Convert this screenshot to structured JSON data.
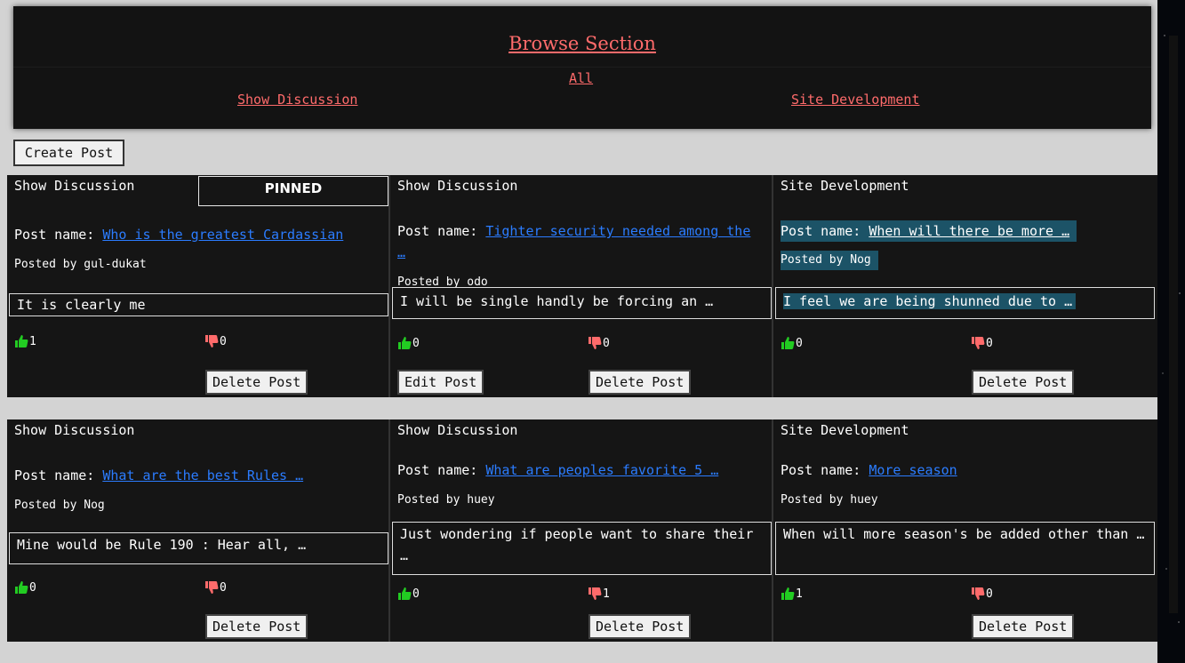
{
  "browse": {
    "title": "Browse Section",
    "links": {
      "all": "All",
      "show_discussion": "Show Discussion",
      "site_development": "Site Development"
    }
  },
  "create_post_label": "Create Post",
  "colors": {
    "accent": "#ff6b6b",
    "link": "#2b7cff",
    "upvote": "#22cc22",
    "downvote": "#ff6b6b",
    "highlight": "#1c5367"
  },
  "posts": [
    {
      "category": "Show Discussion",
      "pinned": "PINNED",
      "post_name_label": "Post name:",
      "post_name": "Who is the greatest Cardassian",
      "posted_by": "Posted by gul-dukat",
      "content": "It is clearly me",
      "upvotes": "1",
      "downvotes": "0",
      "edit_label": "",
      "delete_label": "Delete Post"
    },
    {
      "category": "Show Discussion",
      "post_name_label": "Post name:",
      "post_name": "Tighter security needed among the …",
      "posted_by": "Posted by odo",
      "content": "I will be single handly be forcing an …",
      "upvotes": "0",
      "downvotes": "0",
      "edit_label": "Edit Post",
      "delete_label": "Delete Post"
    },
    {
      "category": "Site Development",
      "post_name_label": "Post name:",
      "post_name": "When will there be more …",
      "posted_by": "Posted by Nog",
      "content": "I feel we are being shunned due to …",
      "upvotes": "0",
      "downvotes": "0",
      "edit_label": "",
      "delete_label": "Delete Post"
    },
    {
      "category": "Show Discussion",
      "post_name_label": "Post name:",
      "post_name": "What are the best Rules …",
      "posted_by": "Posted by Nog",
      "content": "Mine would be Rule 190 : Hear all, …",
      "upvotes": "0",
      "downvotes": "0",
      "edit_label": "",
      "delete_label": "Delete Post"
    },
    {
      "category": "Show Discussion",
      "post_name_label": "Post name:",
      "post_name": "What are peoples favorite 5 …",
      "posted_by": "Posted by huey",
      "content": "Just wondering if people want to share their …",
      "upvotes": "0",
      "downvotes": "1",
      "edit_label": "",
      "delete_label": "Delete Post"
    },
    {
      "category": "Site Development",
      "post_name_label": "Post name:",
      "post_name": "More season",
      "posted_by": "Posted by huey",
      "content": "When will more season's be added other than …",
      "upvotes": "1",
      "downvotes": "0",
      "edit_label": "",
      "delete_label": "Delete Post"
    }
  ]
}
